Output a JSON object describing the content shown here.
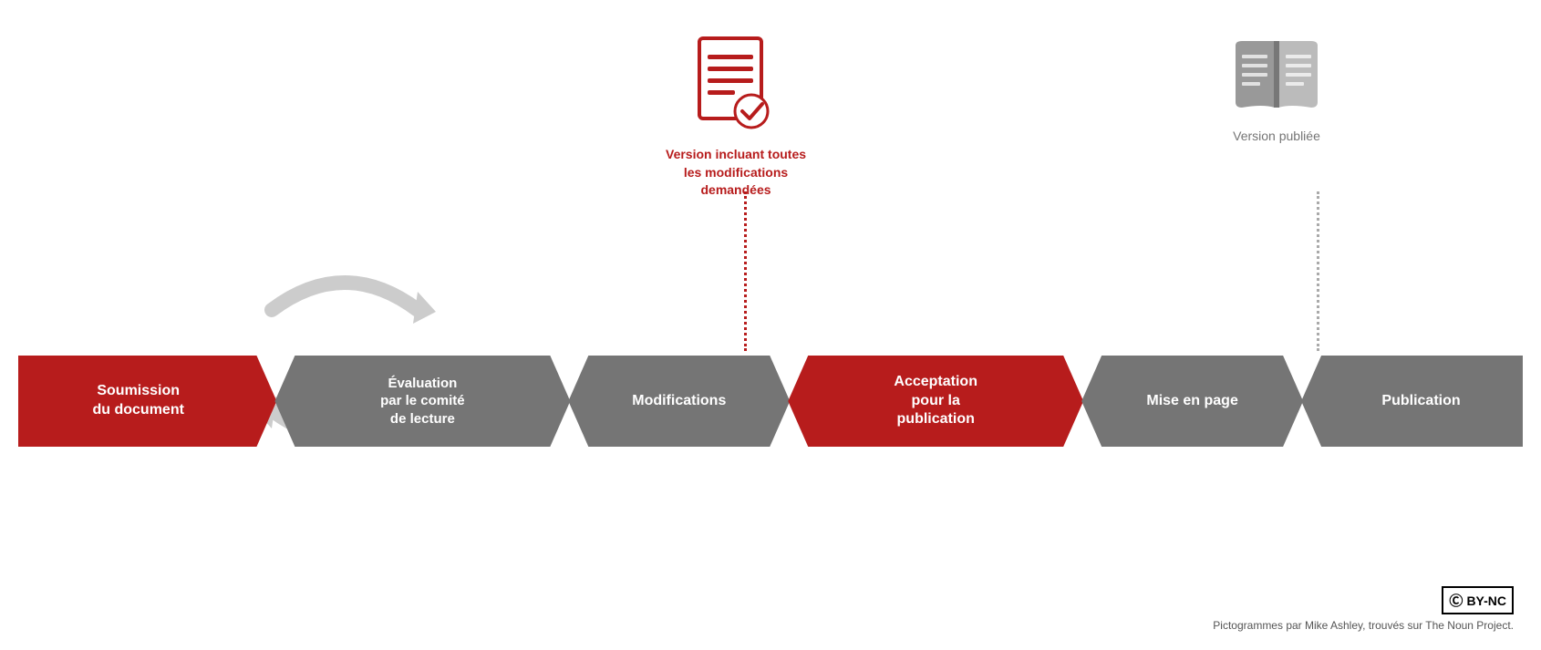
{
  "steps": [
    {
      "id": "soumission",
      "label": "Soumission\ndu document",
      "color": "red",
      "first": true
    },
    {
      "id": "evaluation",
      "label": "Évaluation\npar le comité\nde lecture",
      "color": "gray",
      "first": false
    },
    {
      "id": "modifications",
      "label": "Modifications",
      "color": "gray",
      "first": false
    },
    {
      "id": "acceptation",
      "label": "Acceptation\npour la\npublication",
      "color": "red",
      "first": false
    },
    {
      "id": "mise-en-page",
      "label": "Mise en page",
      "color": "gray",
      "first": false
    },
    {
      "id": "publication",
      "label": "Publication",
      "color": "gray",
      "first": false
    }
  ],
  "doc_red": {
    "label": "Version incluant toutes\nles modifications\ndemandées"
  },
  "doc_gray": {
    "label": "Version publiée"
  },
  "footer": {
    "text": "Pictogrammes par Mike Ashley, trouvés sur The Noun Project.",
    "cc_label": "BY-NC"
  }
}
